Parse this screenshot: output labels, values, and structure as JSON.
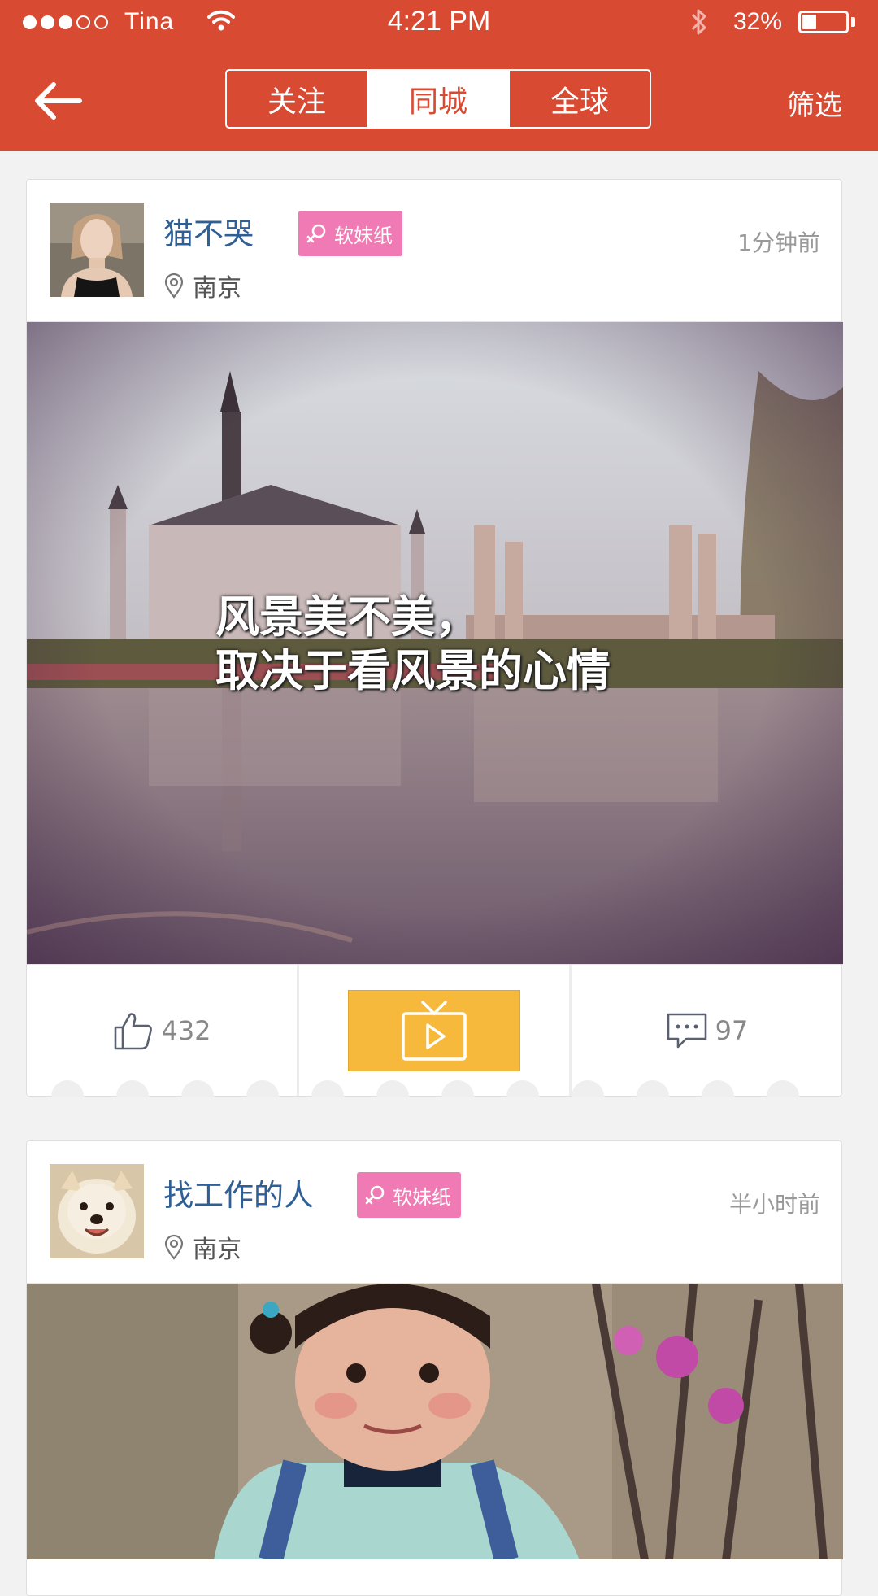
{
  "status_bar": {
    "carrier": "Tina",
    "time": "4:21 PM",
    "battery_pct": "32%",
    "battery_level": 0.32,
    "signal_strength": 3,
    "signal_max": 5
  },
  "navbar": {
    "back_icon": "arrow-left-icon",
    "tabs": [
      {
        "label": "关注",
        "active": false
      },
      {
        "label": "同城",
        "active": true
      },
      {
        "label": "全球",
        "active": false
      }
    ],
    "filter_label": "筛选"
  },
  "colors": {
    "brand_red": "#d94a33",
    "badge_pink": "#f07ab3",
    "video_yellow": "#f6b93b",
    "username_blue": "#2f5f95"
  },
  "posts": [
    {
      "username": "猫不哭",
      "badge": "软妹纸",
      "location": "南京",
      "time": "1分钟前",
      "image_caption_line1": "风景美不美，",
      "image_caption_line2": "取决于看风景的心情",
      "likes": "432",
      "comments": "97"
    },
    {
      "username": "找工作的人",
      "badge": "软妹纸",
      "location": "南京",
      "time": "半小时前"
    }
  ]
}
